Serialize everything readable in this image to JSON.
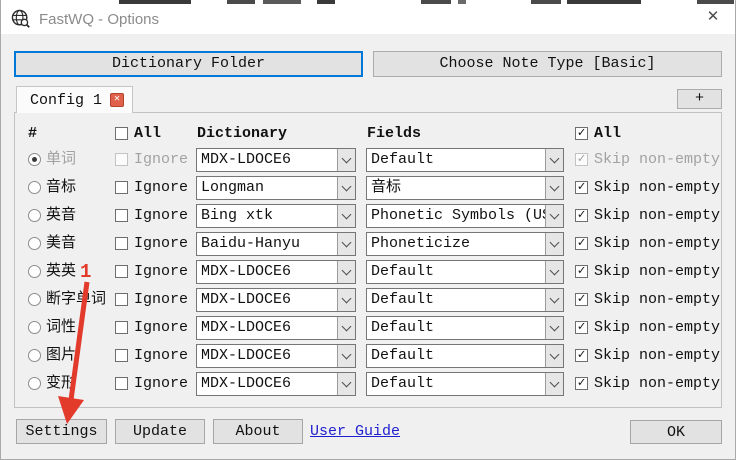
{
  "window": {
    "title": "FastWQ - Options",
    "close_glyph": "✕"
  },
  "toolbar": {
    "dictionary_folder_label": "Dictionary Folder",
    "choose_note_type_label": "Choose Note Type [Basic]"
  },
  "tabs": {
    "active_label": "Config 1",
    "close_glyph": "✕",
    "add_label": "+"
  },
  "table": {
    "headers": {
      "number": "#",
      "all_left": "All",
      "dictionary": "Dictionary",
      "fields": "Fields",
      "all_right": "All",
      "ignore": "Ignore",
      "skip": "Skip non-empty"
    },
    "header_all_left_checked": false,
    "header_all_right_checked": true,
    "rows": [
      {
        "label": "单词",
        "selected": true,
        "disabled": true,
        "ignore": false,
        "dictionary": "MDX-LDOCE6",
        "field": "Default",
        "skip": true
      },
      {
        "label": "音标",
        "selected": false,
        "disabled": false,
        "ignore": false,
        "dictionary": "Longman",
        "field": "音标",
        "skip": true
      },
      {
        "label": "英音",
        "selected": false,
        "disabled": false,
        "ignore": false,
        "dictionary": "Bing xtk",
        "field": "Phonetic Symbols (US)",
        "skip": true
      },
      {
        "label": "美音",
        "selected": false,
        "disabled": false,
        "ignore": false,
        "dictionary": "Baidu-Hanyu",
        "field": "Phoneticize",
        "skip": true
      },
      {
        "label": "英英",
        "selected": false,
        "disabled": false,
        "ignore": false,
        "dictionary": "MDX-LDOCE6",
        "field": "Default",
        "skip": true
      },
      {
        "label": "断字单词",
        "selected": false,
        "disabled": false,
        "ignore": false,
        "dictionary": "MDX-LDOCE6",
        "field": "Default",
        "skip": true
      },
      {
        "label": "词性",
        "selected": false,
        "disabled": false,
        "ignore": false,
        "dictionary": "MDX-LDOCE6",
        "field": "Default",
        "skip": true
      },
      {
        "label": "图片",
        "selected": false,
        "disabled": false,
        "ignore": false,
        "dictionary": "MDX-LDOCE6",
        "field": "Default",
        "skip": true
      },
      {
        "label": "变形",
        "selected": false,
        "disabled": false,
        "ignore": false,
        "dictionary": "MDX-LDOCE6",
        "field": "Default",
        "skip": true
      }
    ]
  },
  "footer": {
    "settings_label": "Settings",
    "update_label": "Update",
    "about_label": "About",
    "user_guide_label": "User Guide",
    "ok_label": "OK"
  },
  "annotation": {
    "number": "1",
    "color": "#e23a2b"
  },
  "colors": {
    "focus_border": "#0078d7",
    "link": "#1f1fd0",
    "tab_close_bg": "#e0614b",
    "dialog_bg": "#f0f0f0"
  }
}
